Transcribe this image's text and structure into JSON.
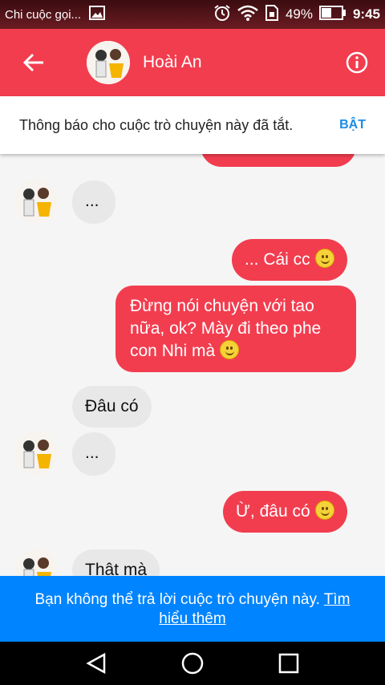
{
  "status_bar": {
    "notification_text": "Chi cuộc gọi...",
    "battery": "49%",
    "time": "9:45"
  },
  "header": {
    "contact_name": "Hoài An"
  },
  "notice": {
    "text": "Thông báo cho cuộc trò chuyện này đã tắt.",
    "action": "BẬT"
  },
  "messages": [
    {
      "dir": "in",
      "text": "..."
    },
    {
      "dir": "out",
      "text": "... Cái cc"
    },
    {
      "dir": "out",
      "lines": [
        "Đừng nói chuyện với tao",
        "nữa, ok? Mày đi theo phe",
        "con Nhi mà"
      ]
    },
    {
      "dir": "in",
      "text": "Đâu có"
    },
    {
      "dir": "in",
      "text": "..."
    },
    {
      "dir": "out",
      "text": "Ừ, đâu có"
    },
    {
      "dir": "in",
      "text": "Thật mà"
    }
  ],
  "bottom_notice": {
    "text": "Bạn không thể trả lời cuộc trò chuyện này.",
    "link": "Tìm hiểu thêm"
  },
  "colors": {
    "accent": "#f23d4f",
    "bottom_notice": "#0084ff",
    "link": "#1a8ce6"
  }
}
